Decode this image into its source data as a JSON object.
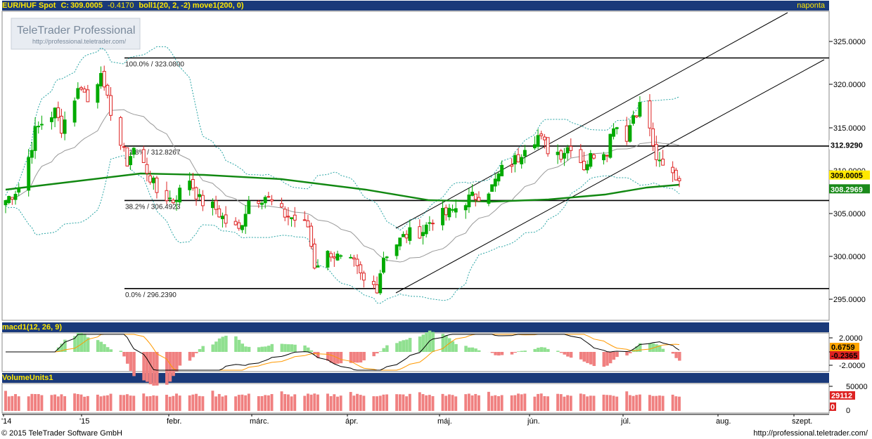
{
  "header": {
    "symbol": "EUR/HUF Spot",
    "close_label": "C:",
    "close_value": "309.0005",
    "change": "-0.4170",
    "indicators": "boll1(20, 2, -2) move1(200, 0)",
    "period": "naponta"
  },
  "watermark": {
    "brand": "TeleTrader Professional",
    "url": "http://professional.teletrader.com/"
  },
  "macd_header": "macd1(12, 26, 9)",
  "volume_header": "VolumeUnits1",
  "footer": {
    "left": "© 2015 TeleTrader Software GmbH",
    "right": "http://professional.teletrader.com/"
  },
  "colors": {
    "header_bg": "#1a3a7a",
    "header_text": "#ffe800",
    "up_candle": "#00aa00",
    "down_candle": "#dd2222",
    "ma200": "#118811",
    "bollinger_mid": "#999999",
    "bollinger_band": "#2aa5a5",
    "histogram_pos": "#90e090",
    "histogram_neg": "#f08080",
    "volume": "#f08080",
    "signal_line": "#ff9900",
    "macd_line": "#000000"
  },
  "chart_data": [
    {
      "type": "candlestick",
      "name": "EUR/HUF Spot",
      "y_ticks": [
        "325.0000",
        "320.0000",
        "315.0000",
        "310.0000",
        "305.0000",
        "300.0000",
        "295.0000"
      ],
      "ylim": [
        292.7,
        328.5
      ],
      "x_ticks": [
        "'14",
        "'15",
        "febr.",
        "márc.",
        "ápr.",
        "máj.",
        "jún.",
        "júl.",
        "aug.",
        "szept."
      ],
      "fib_levels": [
        {
          "label": "100.0% / 323.0800",
          "value": 323.08
        },
        {
          "label": "61.8% / 312.8267",
          "value": 312.8267
        },
        {
          "label": "38.2% / 306.4923",
          "value": 306.4923
        },
        {
          "label": "0.0% / 296.2390",
          "value": 296.239
        }
      ],
      "price_labels": [
        {
          "text": "312.9290",
          "value": 312.929
        },
        {
          "text": "309.0005",
          "value": 309.0005
        },
        {
          "text": "308.2969",
          "value": 308.2969
        }
      ],
      "close_points": [
        {
          "date": "2014-12-29",
          "close": 306.5
        },
        {
          "date": "2015-01-02",
          "close": 308.0
        },
        {
          "date": "2015-01-05",
          "close": 311.5
        },
        {
          "date": "2015-01-07",
          "close": 314.5
        },
        {
          "date": "2015-01-09",
          "close": 315.5
        },
        {
          "date": "2015-01-13",
          "close": 316.8
        },
        {
          "date": "2015-01-15",
          "close": 315.0
        },
        {
          "date": "2015-01-19",
          "close": 318.5
        },
        {
          "date": "2015-01-21",
          "close": 320.0
        },
        {
          "date": "2015-01-23",
          "close": 318.0
        },
        {
          "date": "2015-01-26",
          "close": 320.5
        },
        {
          "date": "2015-01-27",
          "close": 322.0
        },
        {
          "date": "2015-01-28",
          "close": 319.0
        },
        {
          "date": "2015-01-30",
          "close": 317.0
        },
        {
          "date": "2015-02-02",
          "close": 313.0
        },
        {
          "date": "2015-02-04",
          "close": 311.0
        },
        {
          "date": "2015-02-06",
          "close": 312.5
        },
        {
          "date": "2015-02-10",
          "close": 310.0
        },
        {
          "date": "2015-02-13",
          "close": 307.5
        },
        {
          "date": "2015-02-18",
          "close": 306.5
        },
        {
          "date": "2015-02-23",
          "close": 309.0
        },
        {
          "date": "2015-02-26",
          "close": 306.5
        },
        {
          "date": "2015-03-03",
          "close": 305.5
        },
        {
          "date": "2015-03-06",
          "close": 304.0
        },
        {
          "date": "2015-03-10",
          "close": 303.0
        },
        {
          "date": "2015-03-13",
          "close": 306.5
        },
        {
          "date": "2015-03-18",
          "close": 307.0
        },
        {
          "date": "2015-03-23",
          "close": 305.0
        },
        {
          "date": "2015-03-26",
          "close": 304.5
        },
        {
          "date": "2015-03-31",
          "close": 303.5
        },
        {
          "date": "2015-04-02",
          "close": 299.0
        },
        {
          "date": "2015-04-07",
          "close": 300.5
        },
        {
          "date": "2015-04-10",
          "close": 299.5
        },
        {
          "date": "2015-04-14",
          "close": 299.0
        },
        {
          "date": "2015-04-17",
          "close": 297.0
        },
        {
          "date": "2015-04-21",
          "close": 296.5
        },
        {
          "date": "2015-04-23",
          "close": 300.0
        },
        {
          "date": "2015-04-27",
          "close": 301.5
        },
        {
          "date": "2015-04-30",
          "close": 302.5
        },
        {
          "date": "2015-05-05",
          "close": 303.0
        },
        {
          "date": "2015-05-08",
          "close": 304.5
        },
        {
          "date": "2015-05-13",
          "close": 305.0
        },
        {
          "date": "2015-05-18",
          "close": 306.5
        },
        {
          "date": "2015-05-21",
          "close": 307.0
        },
        {
          "date": "2015-05-26",
          "close": 308.0
        },
        {
          "date": "2015-05-29",
          "close": 310.0
        },
        {
          "date": "2015-06-03",
          "close": 311.5
        },
        {
          "date": "2015-06-05",
          "close": 313.0
        },
        {
          "date": "2015-06-09",
          "close": 314.0
        },
        {
          "date": "2015-06-12",
          "close": 312.5
        },
        {
          "date": "2015-06-16",
          "close": 312.0
        },
        {
          "date": "2015-06-19",
          "close": 313.0
        },
        {
          "date": "2015-06-23",
          "close": 310.5
        },
        {
          "date": "2015-06-26",
          "close": 312.0
        },
        {
          "date": "2015-06-30",
          "close": 312.5
        },
        {
          "date": "2015-07-02",
          "close": 315.5
        },
        {
          "date": "2015-07-06",
          "close": 314.0
        },
        {
          "date": "2015-07-08",
          "close": 316.5
        },
        {
          "date": "2015-07-10",
          "close": 317.5
        },
        {
          "date": "2015-07-13",
          "close": 315.0
        },
        {
          "date": "2015-07-14",
          "close": 312.5
        },
        {
          "date": "2015-07-16",
          "close": 310.5
        },
        {
          "date": "2015-07-20",
          "close": 309.5
        },
        {
          "date": "2015-07-22",
          "close": 309.0
        }
      ]
    },
    {
      "type": "line",
      "name": "macd1(12, 26, 9)",
      "y_ticks": [
        "2.0000",
        "0",
        "-2.0000"
      ],
      "value_labels": [
        "0.6759",
        "-0.2365"
      ]
    },
    {
      "type": "bar",
      "name": "VolumeUnits1",
      "y_ticks": [
        "50000",
        "0"
      ],
      "value_labels": [
        "29112",
        "0"
      ]
    }
  ]
}
